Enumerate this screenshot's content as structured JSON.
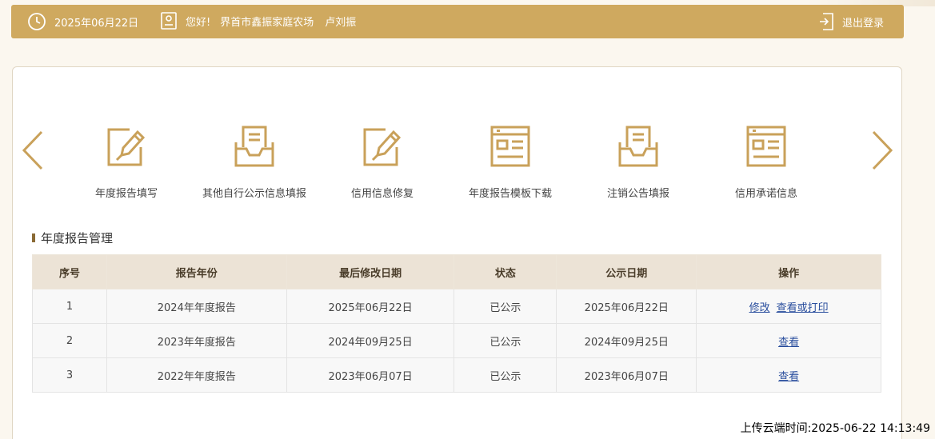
{
  "header": {
    "date": "2025年06月22日",
    "greeting": "您好!",
    "organization": "界首市鑫振家庭农场",
    "person": "卢刘振",
    "logout_label": "退出登录"
  },
  "nav": {
    "items": [
      {
        "label": "年度报告填写",
        "icon": "edit-icon"
      },
      {
        "label": "其他自行公示信息填报",
        "icon": "inbox-document-icon"
      },
      {
        "label": "信用信息修复",
        "icon": "edit-icon"
      },
      {
        "label": "年度报告模板下载",
        "icon": "template-icon"
      },
      {
        "label": "注销公告填报",
        "icon": "inbox-document-icon"
      },
      {
        "label": "信用承诺信息",
        "icon": "template-icon"
      }
    ]
  },
  "section": {
    "title": "年度报告管理"
  },
  "table": {
    "headers": [
      "序号",
      "报告年份",
      "最后修改日期",
      "状态",
      "公示日期",
      "操作"
    ],
    "rows": [
      {
        "index": "1",
        "year": "2024年年度报告",
        "modified": "2025年06月22日",
        "status": "已公示",
        "public_date": "2025年06月22日",
        "actions": [
          "修改",
          "查看或打印"
        ]
      },
      {
        "index": "2",
        "year": "2023年年度报告",
        "modified": "2024年09月25日",
        "status": "已公示",
        "public_date": "2024年09月25日",
        "actions": [
          "查看"
        ]
      },
      {
        "index": "3",
        "year": "2022年年度报告",
        "modified": "2023年06月07日",
        "status": "已公示",
        "public_date": "2023年06月07日",
        "actions": [
          "查看"
        ]
      }
    ]
  },
  "footer": {
    "upload_time": "上传云端时间:2025-06-22 14:13:49"
  },
  "colors": {
    "accent": "#cfa95f",
    "icon": "#c9a15a",
    "link": "#2b4f9e",
    "table_header_bg": "#ece3d6"
  }
}
